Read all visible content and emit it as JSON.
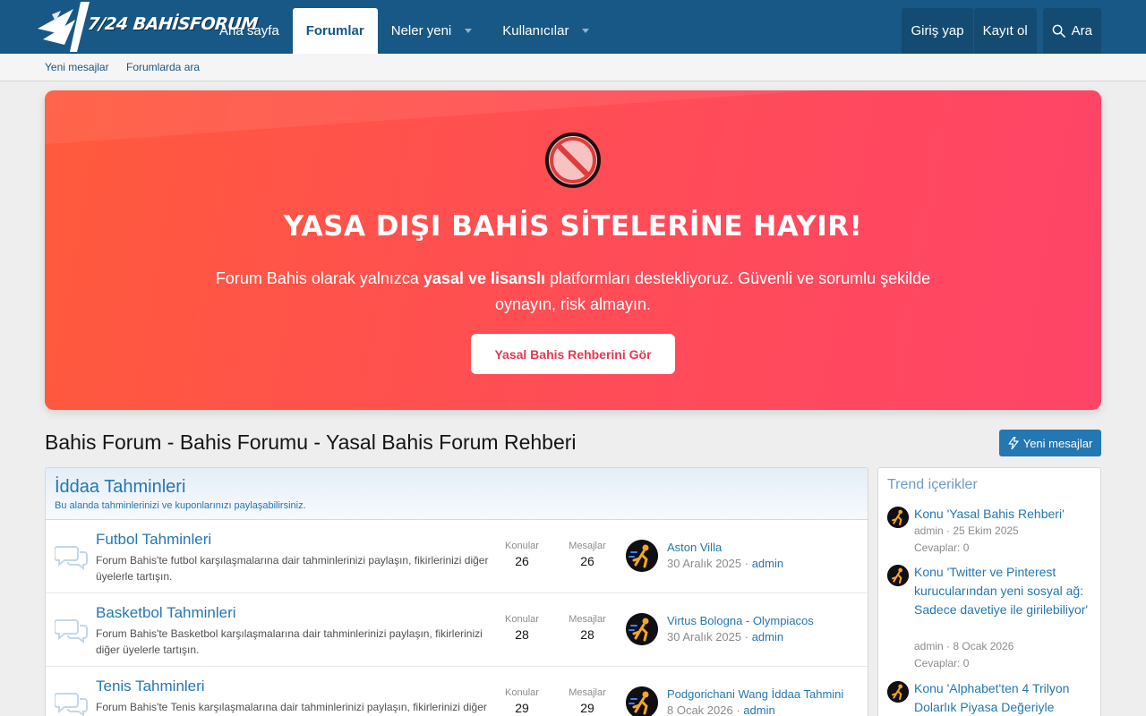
{
  "header": {
    "logo_text": "7/24 BAHİSFORUM",
    "nav": [
      {
        "label": "Ana sayfa",
        "active": false,
        "dropdown": false
      },
      {
        "label": "Forumlar",
        "active": true,
        "dropdown": false
      },
      {
        "label": "Neler yeni",
        "active": false,
        "dropdown": true
      },
      {
        "label": "Kullanıcılar",
        "active": false,
        "dropdown": true
      }
    ],
    "login_label": "Giriş yap",
    "register_label": "Kayıt ol",
    "search_label": "Ara"
  },
  "subnav": {
    "new_posts": "Yeni mesajlar",
    "search_forums": "Forumlarda ara"
  },
  "banner": {
    "title": "YASA DIŞI BAHİS SİTELERİNE HAYIR!",
    "text_before": "Forum Bahis olarak yalnızca ",
    "text_bold": "yasal ve lisanslı",
    "text_after": " platformları destekliyoruz. Güvenli ve sorumlu şekilde oynayın, risk almayın.",
    "button_label": "Yasal Bahis Rehberini Gör"
  },
  "page": {
    "title": "Bahis Forum - Bahis Forumu - Yasal Bahis Forum Rehberi",
    "new_posts_button": "Yeni mesajlar"
  },
  "category": {
    "title": "İddaa Tahminleri",
    "description": "Bu alanda tahminlerinizi ve kuponlarınızı paylaşabilirsiniz.",
    "threads_label": "Konular",
    "posts_label": "Mesajlar",
    "forums": [
      {
        "title": "Futbol Tahminleri",
        "description": "Forum Bahis'te futbol karşılaşmalarına dair tahminlerinizi paylaşın, fikirlerinizi diğer üyelerle tartışın.",
        "threads": "26",
        "posts": "26",
        "last_title": "Aston Villa",
        "last_date": "30 Aralık 2025",
        "last_user": "admin"
      },
      {
        "title": "Basketbol Tahminleri",
        "description": "Forum Bahis'te Basketbol karşılaşmalarına dair tahminlerinizi paylaşın, fikirlerinizi diğer üyelerle tartışın.",
        "threads": "28",
        "posts": "28",
        "last_title": "Virtus Bologna - Olympiacos",
        "last_date": "30 Aralık 2025",
        "last_user": "admin"
      },
      {
        "title": "Tenis Tahminleri",
        "description": "Forum Bahis'te Tenis karşılaşmalarına dair tahminlerinizi paylaşın, fikirlerinizi diğer üyelerle tartışın.",
        "threads": "29",
        "posts": "29",
        "last_title": "Podgorichani Wang İddaa Tahmini",
        "last_date": "8 Ocak 2026",
        "last_user": "admin"
      }
    ]
  },
  "sidebar": {
    "title": "Trend içerikler",
    "items": [
      {
        "title": "Konu 'Yasal Bahis Rehberi'",
        "meta": "admin · 25 Ekim 2025",
        "replies": "Cevaplar: 0"
      },
      {
        "title": "Konu 'Twitter ve Pinterest kurucularından yeni sosyal ağ: Sadece davetiye ile girilebiliyor'",
        "meta": "admin · 8 Ocak 2026",
        "replies": "Cevaplar: 0"
      },
      {
        "title": "Konu 'Alphabet'ten 4 Trilyon Dolarlık Piyasa Değeriyle",
        "meta": "",
        "replies": ""
      }
    ]
  }
}
